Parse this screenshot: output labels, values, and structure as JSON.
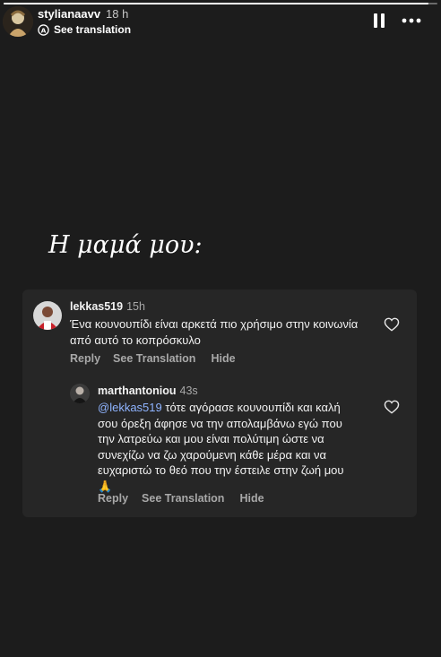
{
  "story": {
    "progress": 0.98,
    "username": "stylianaavv",
    "time_ago": "18 h",
    "see_translation": "See translation",
    "text": "Η μαμά μου:"
  },
  "comment_card": {
    "comment": {
      "username": "lekkas519",
      "time_ago": "15h",
      "text": "Ένα κουνουπίδι είναι αρκετά πιο χρήσιμο στην κοινωνία από αυτό το κοπρόσκυλο",
      "reply": "Reply",
      "see_translation": "See Translation",
      "hide": "Hide"
    },
    "reply": {
      "username": "marthantoniou",
      "time_ago": "43s",
      "mention": "@lekkas519",
      "text": " τότε αγόρασε κουνουπίδι και καλή σου όρεξη άφησε να την απολαμβάνω εγώ που την λατρεύω και μου είναι πολύτιμη ώστε να συνεχίζω να ζω χαρούμενη κάθε μέρα και να ευχαριστώ το θεό που την έστειλε στην ζωή μου",
      "emoji": "🙏",
      "reply": "Reply",
      "see_translation": "See Translation",
      "hide": "Hide"
    }
  }
}
